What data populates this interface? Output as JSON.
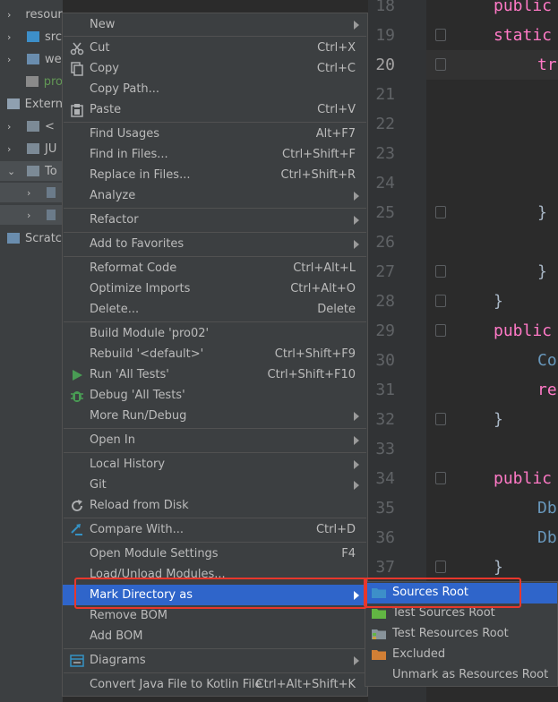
{
  "tree": {
    "rows": [
      {
        "label": "resources",
        "arrow": "›"
      },
      {
        "label": "src",
        "arrow": "›"
      },
      {
        "label": "we",
        "arrow": "›"
      },
      {
        "label": "pro",
        "arrow": ""
      },
      {
        "label": "Extern",
        "arrow": ""
      },
      {
        "label": "<",
        "arrow": "›"
      },
      {
        "label": "JU",
        "arrow": "›"
      },
      {
        "label": "To",
        "arrow": "⌄"
      },
      {
        "label": "",
        "arrow": "›"
      },
      {
        "label": "",
        "arrow": "›"
      },
      {
        "label": "Scratc",
        "arrow": ""
      }
    ]
  },
  "editor": {
    "line_numbers": [
      "18",
      "19",
      "20",
      "21",
      "22",
      "23",
      "24",
      "25",
      "26",
      "27",
      "28",
      "29",
      "30",
      "31",
      "32",
      "33",
      "34",
      "35",
      "36",
      "37"
    ],
    "current_line": "20",
    "code": {
      "l18": "public",
      "l19": "static",
      "l20": "tr",
      "l25": "}",
      "l27": "}",
      "l28": "}",
      "l29": "public",
      "l30": "Co",
      "l31": "re",
      "l32": "}",
      "l34": "public",
      "l35": "Db",
      "l36": "Db",
      "l37": "}"
    }
  },
  "menu": {
    "new": {
      "label": "New"
    },
    "cut": {
      "label": "Cut",
      "shortcut": "Ctrl+X"
    },
    "copy": {
      "label": "Copy",
      "shortcut": "Ctrl+C"
    },
    "copy_path": {
      "label": "Copy Path..."
    },
    "paste": {
      "label": "Paste",
      "shortcut": "Ctrl+V"
    },
    "find_usages": {
      "label": "Find Usages",
      "shortcut": "Alt+F7"
    },
    "find_in_files": {
      "label": "Find in Files...",
      "shortcut": "Ctrl+Shift+F"
    },
    "replace_in_files": {
      "label": "Replace in Files...",
      "shortcut": "Ctrl+Shift+R"
    },
    "analyze": {
      "label": "Analyze"
    },
    "refactor": {
      "label": "Refactor"
    },
    "add_to_favorites": {
      "label": "Add to Favorites"
    },
    "reformat_code": {
      "label": "Reformat Code",
      "shortcut": "Ctrl+Alt+L"
    },
    "optimize_imports": {
      "label": "Optimize Imports",
      "shortcut": "Ctrl+Alt+O"
    },
    "delete": {
      "label": "Delete...",
      "shortcut": "Delete"
    },
    "build_module": {
      "label": "Build Module 'pro02'"
    },
    "rebuild": {
      "label": "Rebuild '<default>'",
      "shortcut": "Ctrl+Shift+F9"
    },
    "run_tests": {
      "label": "Run 'All Tests'",
      "shortcut": "Ctrl+Shift+F10"
    },
    "debug_tests": {
      "label": "Debug 'All Tests'"
    },
    "more_run_debug": {
      "label": "More Run/Debug"
    },
    "open_in": {
      "label": "Open In"
    },
    "local_history": {
      "label": "Local History"
    },
    "git": {
      "label": "Git"
    },
    "reload_from_disk": {
      "label": "Reload from Disk"
    },
    "compare_with": {
      "label": "Compare With...",
      "shortcut": "Ctrl+D"
    },
    "open_module_settings": {
      "label": "Open Module Settings",
      "shortcut": "F4"
    },
    "load_unload_modules": {
      "label": "Load/Unload Modules..."
    },
    "mark_directory_as": {
      "label": "Mark Directory as"
    },
    "remove_bom": {
      "label": "Remove BOM"
    },
    "add_bom": {
      "label": "Add BOM"
    },
    "diagrams": {
      "label": "Diagrams"
    },
    "convert_java": {
      "label": "Convert Java File to Kotlin File",
      "shortcut": "Ctrl+Alt+Shift+K"
    }
  },
  "submenu": {
    "sources_root": {
      "label": "Sources Root"
    },
    "test_sources_root": {
      "label": "Test Sources Root"
    },
    "test_resources_root": {
      "label": "Test Resources Root"
    },
    "excluded": {
      "label": "Excluded"
    },
    "unmark_resources_root": {
      "label": "Unmark as Resources Root"
    }
  },
  "colors": {
    "highlight": "#2f65ca",
    "annotation": "#e8372c",
    "menu_bg": "#3c3f41",
    "keyword_pink": "#ff79c6"
  }
}
